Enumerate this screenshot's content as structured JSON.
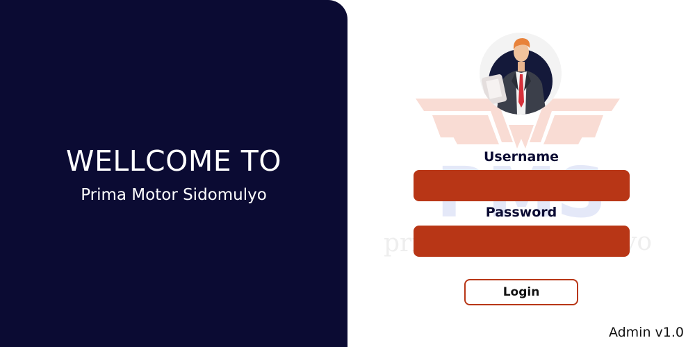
{
  "welcome": {
    "title": "WELLCOME TO",
    "subtitle": "Prima Motor Sidomulyo"
  },
  "login_form": {
    "username_label": "Username",
    "username_value": "",
    "password_label": "Password",
    "password_value": "",
    "login_button": "Login"
  },
  "footer": {
    "version": "Admin v1.0"
  },
  "watermark": {
    "letters": "PMS",
    "tagline_left": "pri",
    "tagline_right": "yo"
  },
  "colors": {
    "panel_bg": "#0b0b33",
    "input_fill": "#b83616",
    "button_border": "#b83616",
    "watermark_blue": "#e4e8f8",
    "watermark_red": "#f9dcd4"
  },
  "icons": {
    "avatar": "businessman-avatar-icon"
  }
}
